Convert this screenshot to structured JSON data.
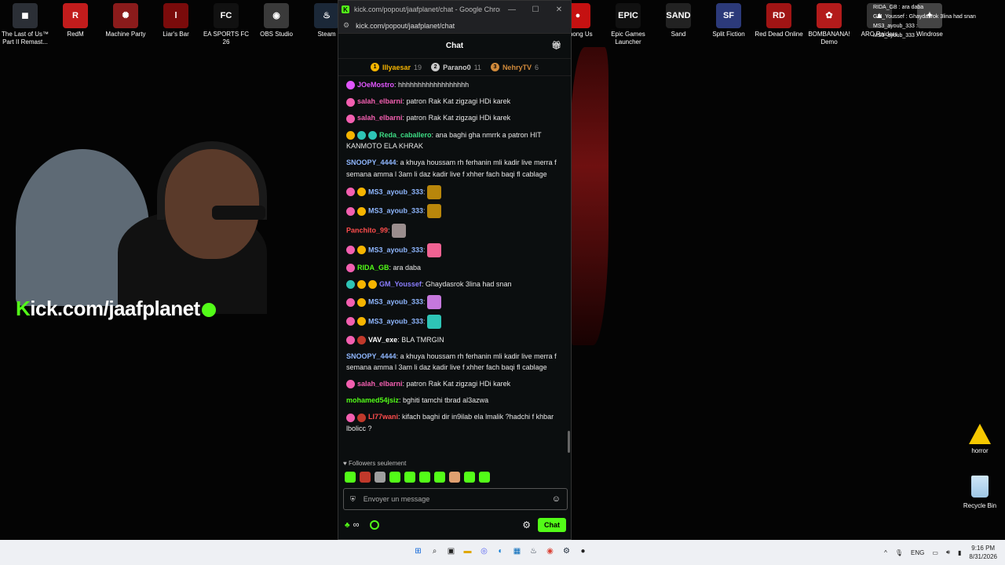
{
  "desktop": {
    "icons": [
      {
        "label": "The Last of Us™ Part II Remast...",
        "glyph": "◼",
        "color": "#2b2f36"
      },
      {
        "label": "RedM",
        "glyph": "R",
        "color": "#c21c1c"
      },
      {
        "label": "Machine Party",
        "glyph": "✺",
        "color": "#8a1b1b"
      },
      {
        "label": "Liar's Bar",
        "glyph": "l",
        "color": "#7a0b0b"
      },
      {
        "label": "EA SPORTS FC 26",
        "glyph": "FC",
        "color": "#111111"
      },
      {
        "label": "OBS Studio",
        "glyph": "◉",
        "color": "#3a3a3a"
      },
      {
        "label": "Steam",
        "glyph": "♨",
        "color": "#1b2838"
      },
      {
        "label": "Among Us",
        "glyph": "●",
        "color": "#c51111"
      },
      {
        "label": "Epic Games Launcher",
        "glyph": "EPIC",
        "color": "#111111"
      },
      {
        "label": "Sand",
        "glyph": "SAND",
        "color": "#222222"
      },
      {
        "label": "Split Fiction",
        "glyph": "SF",
        "color": "#2c3a7a"
      },
      {
        "label": "Red Dead Online",
        "glyph": "RD",
        "color": "#a01414"
      },
      {
        "label": "BOMBANANA! Demo",
        "glyph": "✿",
        "color": "#b31b1b"
      },
      {
        "label": "ARC Raiders",
        "glyph": "▲",
        "color": "#333333"
      },
      {
        "label": "Windrose",
        "glyph": "✦",
        "color": "#444444"
      }
    ],
    "horror_label": "horror",
    "recycle_label": "Recycle Bin",
    "kick_overlay": "ick.com/jaafplanet",
    "kick_overlay_k": "K",
    "mini_chat": [
      "RIDA_GB : ara daba",
      "GM_Youssef : Ghaydasrok 3lina had snan",
      "MS3_ayoub_333 :",
      "MS3_ayoub_333 :"
    ]
  },
  "window": {
    "title": "kick.com/popout/jaafplanet/chat - Google Chrome",
    "url": "kick.com/popout/jaafplanet/chat",
    "minimize": "—",
    "maximize": "☐",
    "close": "✕"
  },
  "chat": {
    "header": "Chat",
    "leaderboard": [
      {
        "rank": "1",
        "name": "Illyaesar",
        "count": "19",
        "color": "#f5b400"
      },
      {
        "rank": "2",
        "name": "Parano0",
        "count": "11",
        "color": "#c9c9c9"
      },
      {
        "rank": "3",
        "name": "NehryTV",
        "count": "6",
        "color": "#d08a3b"
      }
    ],
    "messages": [
      {
        "user": "JOeMostro",
        "color": "#e056fd",
        "badges": [
          "#e056fd"
        ],
        "text": "hhhhhhhhhhhhhhhhhh"
      },
      {
        "user": "salah_elbarni",
        "color": "#f35fb0",
        "badges": [
          "#f35fb0"
        ],
        "text": "patron Rak Kat zigzagi HDi karek"
      },
      {
        "user": "salah_elbarni",
        "color": "#f35fb0",
        "badges": [
          "#f35fb0"
        ],
        "text": "patron Rak Kat zigzagi HDi karek"
      },
      {
        "user": "Reda_caballero",
        "color": "#3ddc84",
        "badges": [
          "#f5b400",
          "#2ec4b6",
          "#2ec4b6"
        ],
        "text": "ana baghi gha nmrrk a patron HIT KANMOTO ELA KHRAK"
      },
      {
        "user": "SNOOPY_4444",
        "color": "#8fb7ff",
        "badges": [],
        "text": "a khuya houssam rh ferhanin mli kadir live merra f semana amma l 3am li daz kadir live f xhher fach baqi fl cablage"
      },
      {
        "user": "MS3_ayoub_333",
        "color": "#8fb7ff",
        "badges": [
          "#f35fb0",
          "#f5b400"
        ],
        "text": "",
        "emote": "#b8860b"
      },
      {
        "user": "MS3_ayoub_333",
        "color": "#8fb7ff",
        "badges": [
          "#f35fb0",
          "#f5b400"
        ],
        "text": "",
        "emote": "#b8860b"
      },
      {
        "user": "Panchito_99",
        "color": "#ff4d4d",
        "badges": [],
        "text": "",
        "emote": "#9a8d8d"
      },
      {
        "user": "MS3_ayoub_333",
        "color": "#8fb7ff",
        "badges": [
          "#f35fb0",
          "#f5b400"
        ],
        "text": "",
        "emote": "#f06292"
      },
      {
        "user": "RIDA_GB",
        "color": "#53fc18",
        "badges": [
          "#f35fb0"
        ],
        "text": "ara daba"
      },
      {
        "user": "GM_Youssef",
        "color": "#8a7dff",
        "badges": [
          "#2ec4b6",
          "#f5b400",
          "#f5b400"
        ],
        "text": "Ghaydasrok 3lina had snan"
      },
      {
        "user": "MS3_ayoub_333",
        "color": "#8fb7ff",
        "badges": [
          "#f35fb0",
          "#f5b400"
        ],
        "text": "",
        "emote": "#c678dd"
      },
      {
        "user": "MS3_ayoub_333",
        "color": "#8fb7ff",
        "badges": [
          "#f35fb0",
          "#f5b400"
        ],
        "text": "",
        "emote": "#2ec4b6"
      },
      {
        "user": "VAV_exe",
        "color": "#ffffff",
        "badges": [
          "#f35fb0",
          "#c0392b"
        ],
        "text": "BLA TMRGIN"
      },
      {
        "user": "SNOOPY_4444",
        "color": "#8fb7ff",
        "badges": [],
        "text": "a khuya houssam rh ferhanin mli kadir live merra f semana amma l 3am li daz kadir live f xhher fach baqi fl cablage"
      },
      {
        "user": "salah_elbarni",
        "color": "#f35fb0",
        "badges": [
          "#f35fb0"
        ],
        "text": "patron Rak Kat zigzagi HDi karek"
      },
      {
        "user": "mohamed54jsiz",
        "color": "#53fc18",
        "badges": [],
        "text": "bghiti tamchi tbrad al3azwa"
      },
      {
        "user": "LI77wani",
        "color": "#ff4d4d",
        "badges": [
          "#f35fb0",
          "#c0392b"
        ],
        "text": "kifach baghi dir in9ilab ela lmalik ?hadchi f khbar lbolicc ?"
      }
    ],
    "followers_only": "Followers seulement",
    "input_placeholder": "Envoyer un message",
    "send_label": "Chat",
    "infinity": "∞"
  },
  "taskbar": {
    "lang": "ENG",
    "time": "9:16 PM",
    "date": "8/31/2026"
  }
}
